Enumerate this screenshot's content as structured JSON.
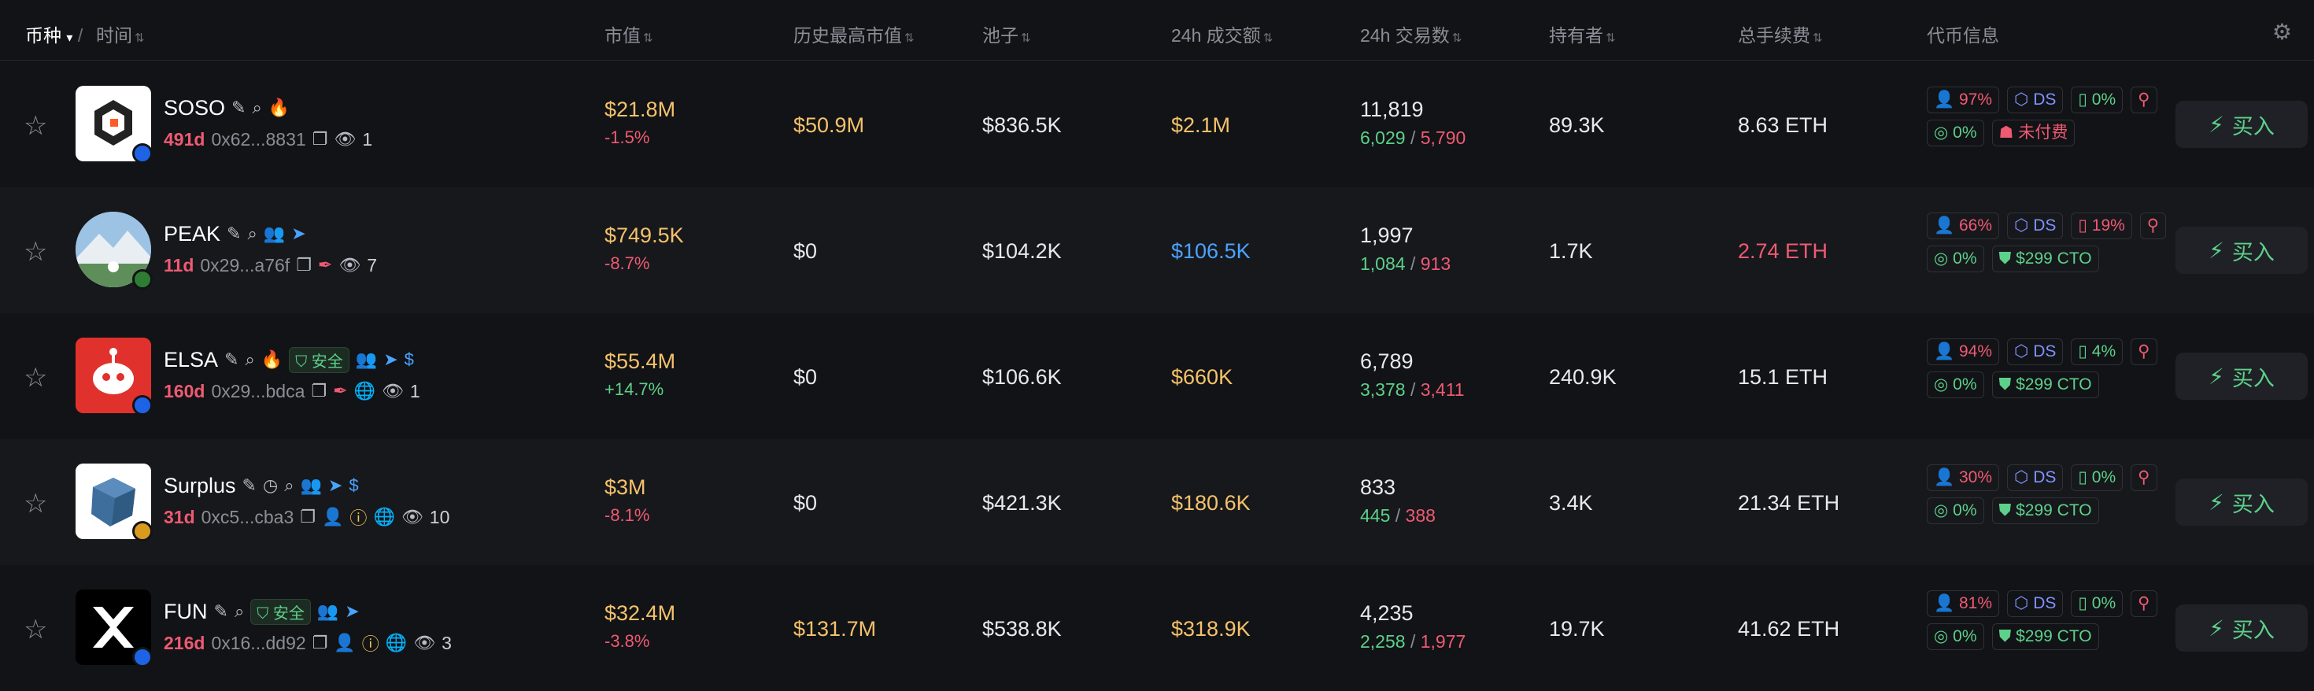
{
  "header": {
    "coin": "币种",
    "coin_arrow": "▾",
    "sep": "/",
    "time": "时间",
    "mcap": "市值",
    "ath": "历史最高市值",
    "pool": "池子",
    "vol": "24h 成交额",
    "tx": "24h 交易数",
    "holders": "持有者",
    "fees": "总手续费",
    "info": "代币信息",
    "sort_glyph": "⇅",
    "settings_icon": "gear-icon"
  },
  "colors": {
    "positive": "#5dd08a",
    "negative": "#ef5a73",
    "highlight": "#f5c26b",
    "accent_blue": "#4aa3ff"
  },
  "rows": [
    {
      "name": "SOSO",
      "age": "491d",
      "address": "0x62...8831",
      "views": "1",
      "market_cap": "$21.8M",
      "change": "-1.5%",
      "ath": "$50.9M",
      "pool": "$836.5K",
      "volume": "$2.1M",
      "tx_total": "11,819",
      "tx_buy": "6,029",
      "tx_sell": "5,790",
      "holders": "89.3K",
      "fees": "8.63 ETH",
      "chips_top": [
        "97%",
        "DS",
        "0%",
        ""
      ],
      "chips_bottom": [
        "0%",
        "未付费"
      ],
      "buy_label": "买入"
    },
    {
      "name": "PEAK",
      "age": "11d",
      "address": "0x29...a76f",
      "views": "7",
      "market_cap": "$749.5K",
      "change": "-8.7%",
      "ath": "$0",
      "pool": "$104.2K",
      "volume": "$106.5K",
      "tx_total": "1,997",
      "tx_buy": "1,084",
      "tx_sell": "913",
      "holders": "1.7K",
      "fees": "2.74 ETH",
      "chips_top": [
        "66%",
        "DS",
        "19%",
        ""
      ],
      "chips_bottom": [
        "0%",
        "$299 CTO"
      ],
      "buy_label": "买入"
    },
    {
      "name": "ELSA",
      "age": "160d",
      "address": "0x29...bdca",
      "safe_label": "安全",
      "views": "1",
      "market_cap": "$55.4M",
      "change": "+14.7%",
      "ath": "$0",
      "pool": "$106.6K",
      "volume": "$660K",
      "tx_total": "6,789",
      "tx_buy": "3,378",
      "tx_sell": "3,411",
      "holders": "240.9K",
      "fees": "15.1 ETH",
      "chips_top": [
        "94%",
        "DS",
        "4%",
        ""
      ],
      "chips_bottom": [
        "0%",
        "$299 CTO"
      ],
      "buy_label": "买入"
    },
    {
      "name": "Surplus",
      "age": "31d",
      "address": "0xc5...cba3",
      "views": "10",
      "market_cap": "$3M",
      "change": "-8.1%",
      "ath": "$0",
      "pool": "$421.3K",
      "volume": "$180.6K",
      "tx_total": "833",
      "tx_buy": "445",
      "tx_sell": "388",
      "holders": "3.4K",
      "fees": "21.34 ETH",
      "chips_top": [
        "30%",
        "DS",
        "0%",
        ""
      ],
      "chips_bottom": [
        "0%",
        "$299 CTO"
      ],
      "buy_label": "买入"
    },
    {
      "name": "FUN",
      "age": "216d",
      "address": "0x16...dd92",
      "safe_label": "安全",
      "views": "3",
      "market_cap": "$32.4M",
      "change": "-3.8%",
      "ath": "$131.7M",
      "pool": "$538.8K",
      "volume": "$318.9K",
      "tx_total": "4,235",
      "tx_buy": "2,258",
      "tx_sell": "1,977",
      "holders": "19.7K",
      "fees": "41.62 ETH",
      "chips_top": [
        "81%",
        "DS",
        "0%",
        ""
      ],
      "chips_bottom": [
        "0%",
        "$299 CTO"
      ],
      "buy_label": "买入"
    }
  ]
}
